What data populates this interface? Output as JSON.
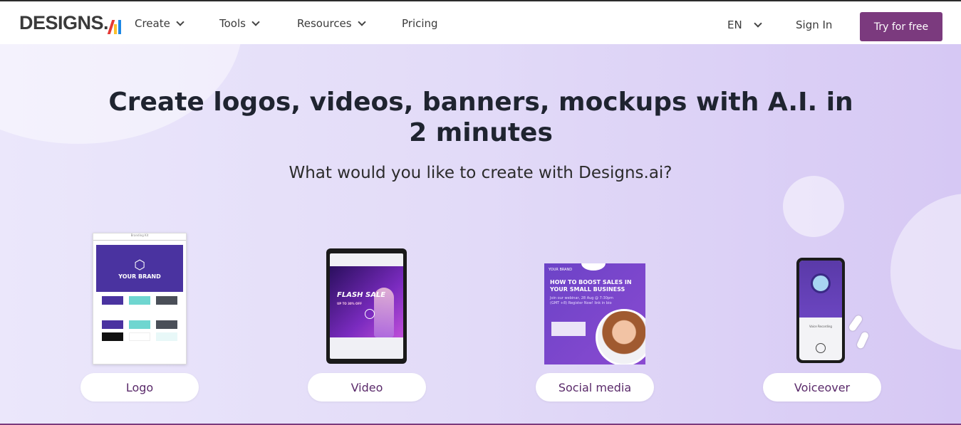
{
  "nav": {
    "logo_text": "DESIGNS.",
    "logo_colors": [
      "#e53935",
      "#1e88e5",
      "#fbc02d"
    ],
    "links": [
      {
        "label": "Create",
        "has_dropdown": true
      },
      {
        "label": "Tools",
        "has_dropdown": true
      },
      {
        "label": "Resources",
        "has_dropdown": true
      },
      {
        "label": "Pricing",
        "has_dropdown": false
      }
    ],
    "language": "EN",
    "sign_in": "Sign In",
    "cta": "Try for free",
    "cta_color": "#7b3a7e"
  },
  "hero": {
    "headline": "Create logos, videos, banners, mockups with A.I. in 2 minutes",
    "subheadline": "What would you like to create with Designs.ai?"
  },
  "cards": [
    {
      "label": "Logo",
      "preview": {
        "title": "YOUR BRAND"
      }
    },
    {
      "label": "Video",
      "preview": {
        "title": "FLASH SALE",
        "subtitle": "UP TO 30% OFF"
      }
    },
    {
      "label": "Social media",
      "preview": {
        "brand": "YOUR BRAND",
        "title": "HOW TO BOOST SALES IN YOUR SMALL BUSINESS",
        "body": "Join our webinar, 28 Aug @ 7:30pm (GMT +8) Register Now! link in bio"
      }
    },
    {
      "label": "Voiceover",
      "preview": {
        "caption": "Voice Recording"
      }
    }
  ]
}
